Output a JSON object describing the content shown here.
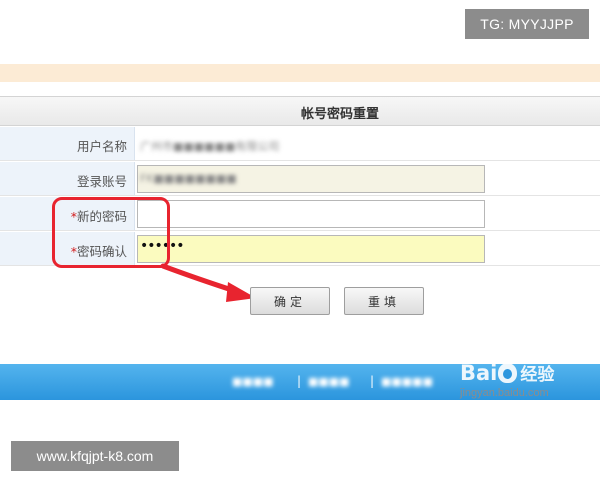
{
  "overlay": {
    "tg_badge": "TG: MYYJJPP",
    "site_badge": "www.kfqjpt-k8.com"
  },
  "form": {
    "title": "帐号密码重置",
    "rows": [
      {
        "label": "用户名称",
        "required": false,
        "value": "广州市■■■■■■有限公司"
      },
      {
        "label": "登录账号",
        "required": false,
        "value": "FK■■■■■■■■"
      },
      {
        "label": "新的密码",
        "required": true,
        "value": ""
      },
      {
        "label": "密码确认",
        "required": true,
        "value": "••••••"
      }
    ],
    "required_mark": "*",
    "confirm_button": "确定",
    "reset_button": "重填"
  },
  "annotation": {
    "box_color": "#e8242f",
    "arrow_color": "#e8242f",
    "arrow_icon": "red-arrow-icon"
  },
  "footer": {
    "links": [
      "■■■■",
      "■■■■",
      "■■■■■"
    ],
    "separator": "|"
  },
  "watermark": {
    "brand_left": "Bai",
    "brand_right": "经验",
    "url": "jingyan.baidu.com"
  },
  "colors": {
    "footer_bar": "#2b95dd",
    "top_band": "#fcebd5",
    "label_cell": "#edf3fa",
    "confirm_field": "#fbfbbf",
    "required": "#d11a1a"
  }
}
